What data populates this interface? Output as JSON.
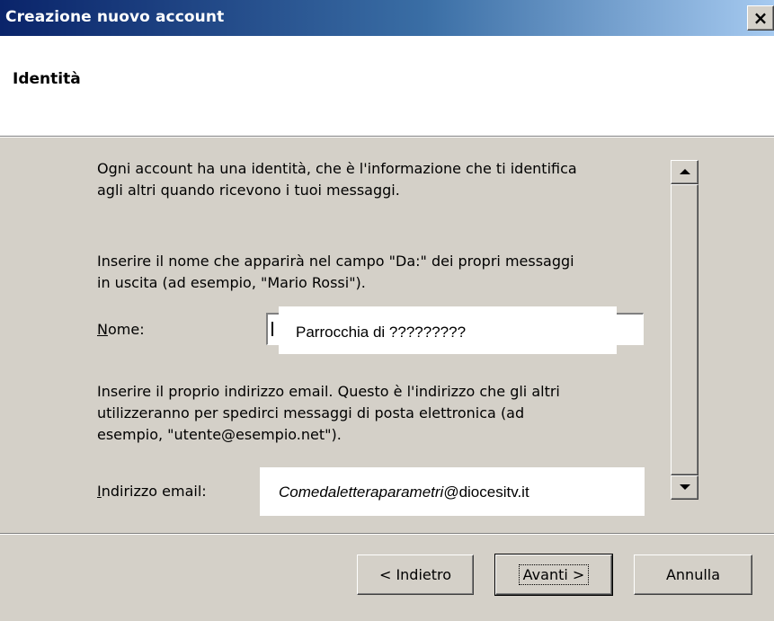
{
  "window": {
    "title": "Creazione nuovo account",
    "close_symbol": "×"
  },
  "header": {
    "title": "Identità"
  },
  "content": {
    "paragraph1_line1": "Ogni account ha una identità, che è l'informazione che ti identifica",
    "paragraph1_line2": "agli altri quando ricevono i tuoi messaggi.",
    "paragraph2_line1": "Inserire il nome che apparirà nel campo \"Da:\" dei propri messaggi",
    "paragraph2_line2": "in uscita (ad esempio, \"Mario Rossi\").",
    "paragraph3_line1": "Inserire il proprio indirizzo email. Questo è l'indirizzo che gli altri",
    "paragraph3_line2": "utilizzeranno per spedirci messaggi di posta elettronica (ad",
    "paragraph3_line3": "esempio, \"utente@esempio.net\")."
  },
  "form": {
    "name_label_accesskey": "N",
    "name_label_rest": "ome:",
    "name_value": "Parrocchia di ?????????",
    "email_label_accesskey": "I",
    "email_label_rest": "ndirizzo email:",
    "email_value_italic": "Comedaletteraparametri",
    "email_value_rest": "@diocesitv.it"
  },
  "buttons": {
    "back": "< Indietro",
    "next": "Avanti >",
    "cancel": "Annulla"
  },
  "icons": {
    "scroll_up": "triangle-up",
    "scroll_down": "triangle-down"
  },
  "colors": {
    "titlebar_start": "#0a246a",
    "titlebar_end": "#a6caf0",
    "dialog_face": "#d4d0c8"
  }
}
